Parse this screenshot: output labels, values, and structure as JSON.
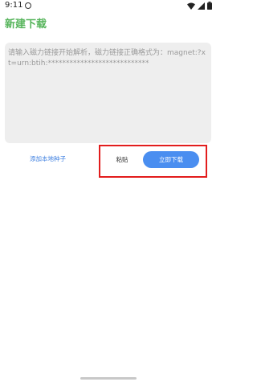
{
  "status_bar": {
    "time": "9:11",
    "icons": [
      "record-indicator-icon",
      "wifi-icon",
      "cellular-signal-icon",
      "battery-icon"
    ]
  },
  "header": {
    "title": "新建下载"
  },
  "magnet_input": {
    "value": "",
    "placeholder": "请输入磁力链接开始解析，磁力链接正确格式为：magnet:?xt=urn:btih:****************************"
  },
  "actions": {
    "add_local_torrent": "添加本地种子",
    "paste": "粘贴",
    "download_now": "立即下载"
  },
  "colors": {
    "title_green": "#55b45a",
    "button_blue": "#4a8ef0",
    "link_blue": "#3d7fe0",
    "highlight_red": "#e21d1d",
    "input_bg": "#eeeeee"
  }
}
